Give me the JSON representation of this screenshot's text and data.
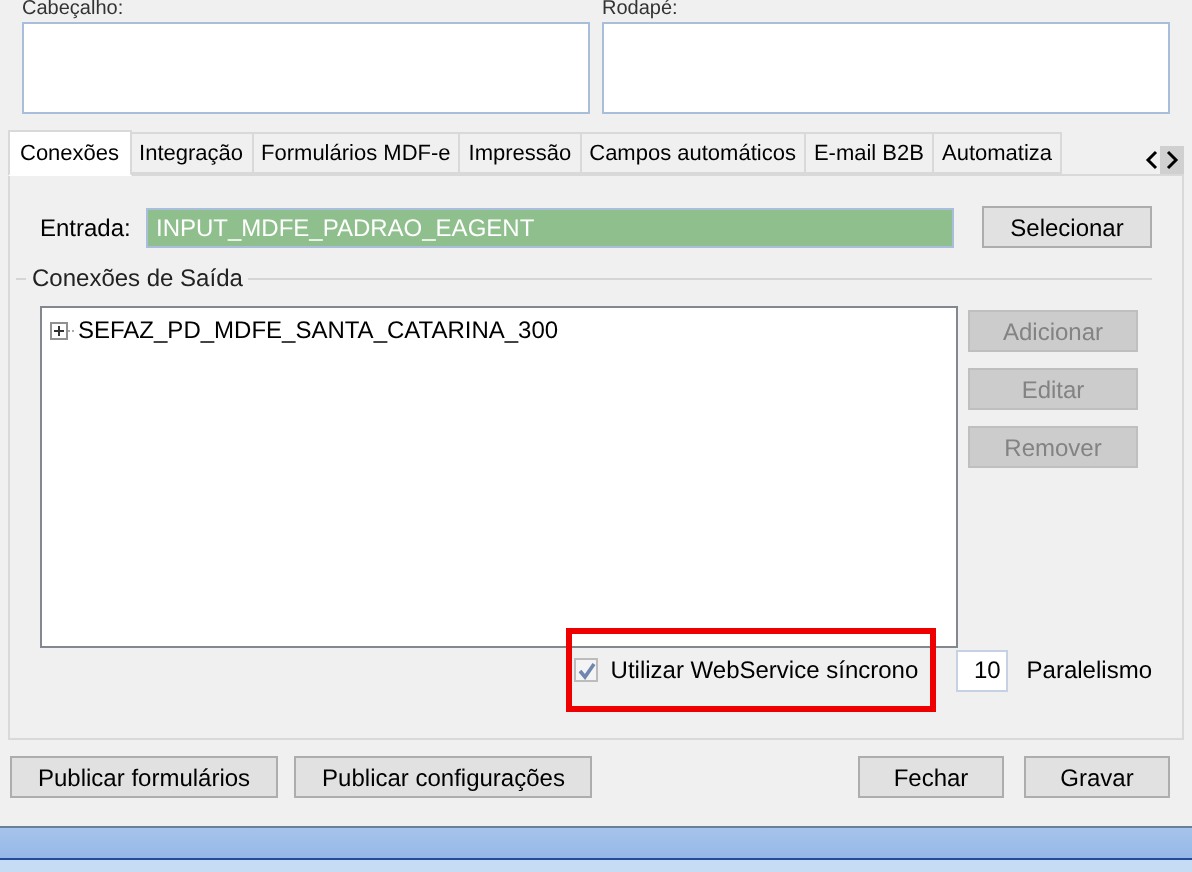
{
  "header_fields": [
    {
      "label": "Cabeçalho:"
    },
    {
      "label": "Rodapé:"
    }
  ],
  "tabs": [
    {
      "label": "Conexões",
      "selected": true
    },
    {
      "label": "Integração",
      "selected": false
    },
    {
      "label": "Formulários MDF-e",
      "selected": false
    },
    {
      "label": "Impressão",
      "selected": false
    },
    {
      "label": "Campos automáticos",
      "selected": false
    },
    {
      "label": "E-mail B2B",
      "selected": false
    },
    {
      "label": "Automatiza",
      "selected": false
    }
  ],
  "entrada": {
    "label": "Entrada:",
    "value": "INPUT_MDFE_PADRAO_EAGENT",
    "button": "Selecionar"
  },
  "output_group": {
    "title": "Conexões de Saída",
    "tree": [
      {
        "label": "SEFAZ_PD_MDFE_SANTA_CATARINA_300",
        "expanded": false
      }
    ],
    "buttons": [
      {
        "label": "Adicionar",
        "disabled": true
      },
      {
        "label": "Editar",
        "disabled": true
      },
      {
        "label": "Remover",
        "disabled": true
      }
    ]
  },
  "sync_checkbox": {
    "label": "Utilizar WebService síncrono",
    "checked": true
  },
  "parallelism": {
    "value": "10",
    "label": "Paralelismo"
  },
  "footer_buttons": [
    "Publicar formulários",
    "Publicar configurações"
  ],
  "dialog_buttons": [
    "Fechar",
    "Gravar"
  ]
}
